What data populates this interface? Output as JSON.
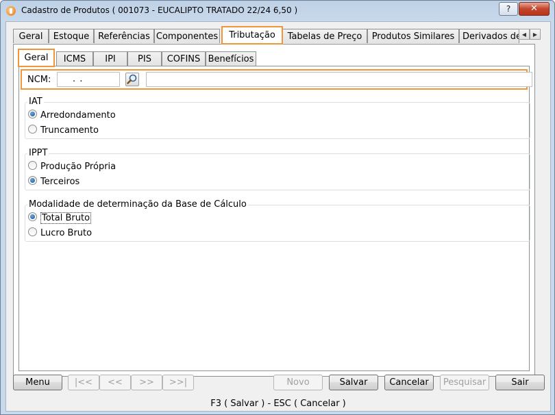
{
  "window": {
    "title": "Cadastro de Produtos ( 001073 - EUCALIPTO TRATADO 22/24 6,50 )",
    "help_label": "?",
    "close_label": "✕"
  },
  "outer_tabs": [
    "Geral",
    "Estoque",
    "Referências",
    "Componentes",
    "Tributação",
    "Tabelas de Preço",
    "Produtos Similares",
    "Derivados de"
  ],
  "tab_scroll": {
    "left": "◀",
    "right": "▶"
  },
  "inner_tabs": [
    "Geral",
    "ICMS",
    "IPI",
    "PIS",
    "COFINS",
    "Benefícios"
  ],
  "ncm": {
    "label": "NCM:",
    "value": ". .",
    "description": ""
  },
  "groups": {
    "iat": {
      "title": "IAT",
      "options": [
        {
          "label": "Arredondamento",
          "selected": true
        },
        {
          "label": "Truncamento",
          "selected": false
        }
      ]
    },
    "ippt": {
      "title": "IPPT",
      "options": [
        {
          "label": "Produção Própria",
          "selected": false
        },
        {
          "label": "Terceiros",
          "selected": true
        }
      ]
    },
    "modalidade": {
      "title": "Modalidade de determinação da Base de Cálculo",
      "options": [
        {
          "label": "Total Bruto",
          "selected": true
        },
        {
          "label": "Lucro Bruto",
          "selected": false
        }
      ]
    }
  },
  "buttons": {
    "menu": "Menu",
    "first": "|<<",
    "prev": "<<",
    "next": ">>",
    "last": ">>|",
    "novo": "Novo",
    "salvar": "Salvar",
    "cancelar": "Cancelar",
    "pesquisar": "Pesquisar",
    "sair": "Sair"
  },
  "status_bar": "F3 ( Salvar )  -  ESC ( Cancelar )"
}
